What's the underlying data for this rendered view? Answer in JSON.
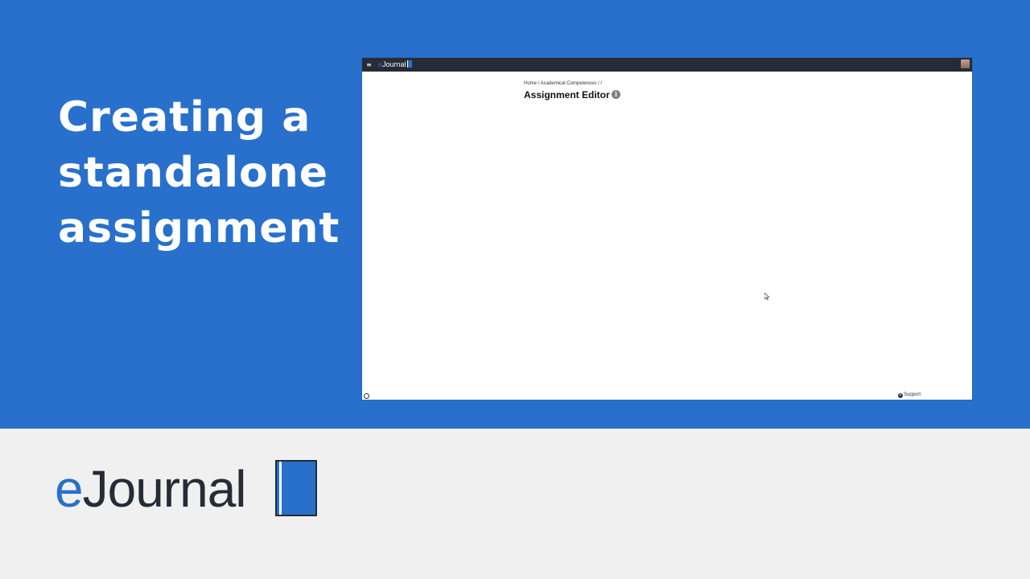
{
  "headline": {
    "lines": [
      "Creating a",
      "standalone",
      "assignment"
    ]
  },
  "app": {
    "brand": {
      "prefix": "e",
      "name": "Journal"
    },
    "breadcrumb": "Home / Academical Competences / / ",
    "page_title": "Assignment Editor",
    "info_symbol": "i",
    "support_label": "Support",
    "menu_symbol": "≡"
  },
  "logo": {
    "prefix": "e",
    "name": "Journal"
  },
  "colors": {
    "brand_blue": "#2870cb",
    "navbar": "#252c36",
    "background_light": "#f0f0f0"
  },
  "icons": [
    "menu-icon",
    "avatar",
    "info-icon",
    "cursor-icon",
    "loader-icon",
    "support-icon",
    "book-icon"
  ]
}
